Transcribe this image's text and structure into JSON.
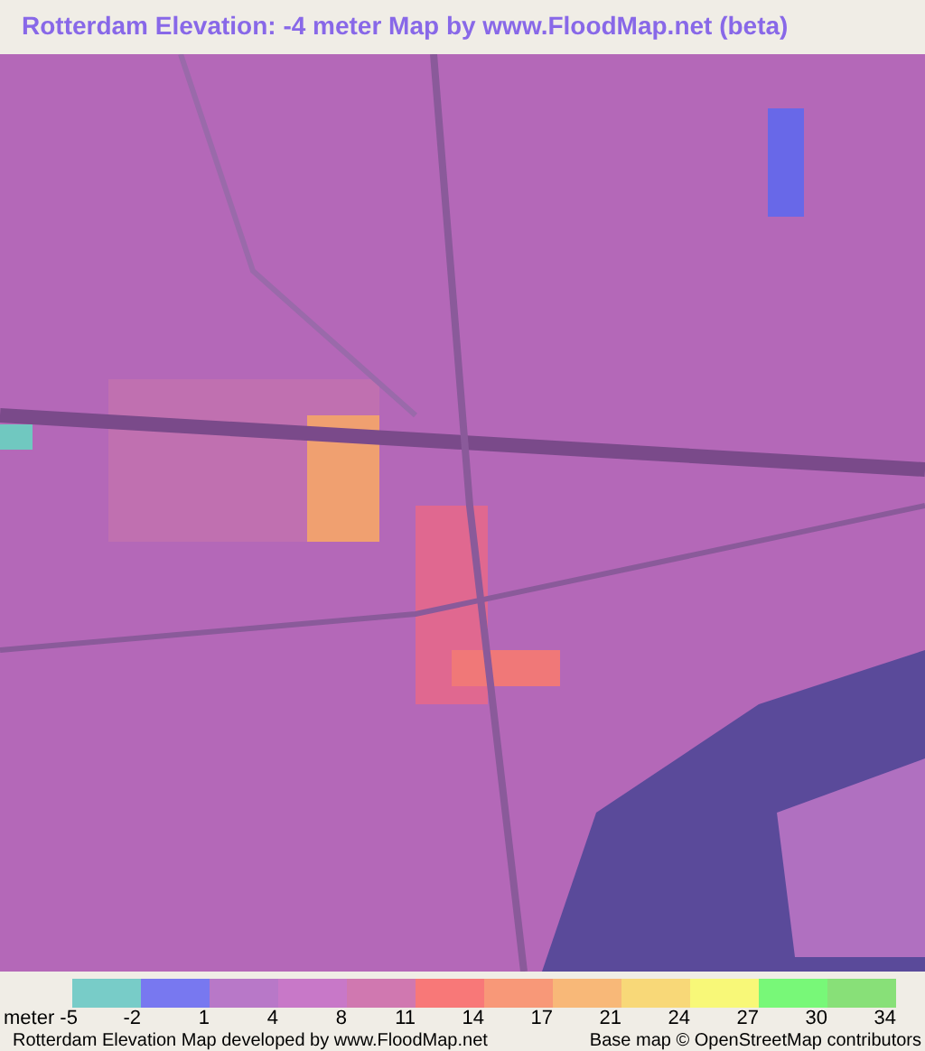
{
  "title": "Rotterdam Elevation: -4 meter Map by www.FloodMap.net (beta)",
  "legend": {
    "swatches": [
      {
        "color": "#78ccc8"
      },
      {
        "color": "#7878f0"
      },
      {
        "color": "#b878c8"
      },
      {
        "color": "#c878c8"
      },
      {
        "color": "#d078b0"
      },
      {
        "color": "#f87878"
      },
      {
        "color": "#f89878"
      },
      {
        "color": "#f8b878"
      },
      {
        "color": "#f8d878"
      },
      {
        "color": "#f8f878"
      },
      {
        "color": "#78f878"
      },
      {
        "color": "#88e078"
      }
    ],
    "labels": [
      "meter -5",
      "-2",
      "1",
      "4",
      "8",
      "11",
      "14",
      "17",
      "21",
      "24",
      "27",
      "30",
      "34"
    ]
  },
  "footer": {
    "credit": "Rotterdam Elevation Map developed by www.FloodMap.net",
    "attribution": "Base map © OpenStreetMap contributors"
  }
}
